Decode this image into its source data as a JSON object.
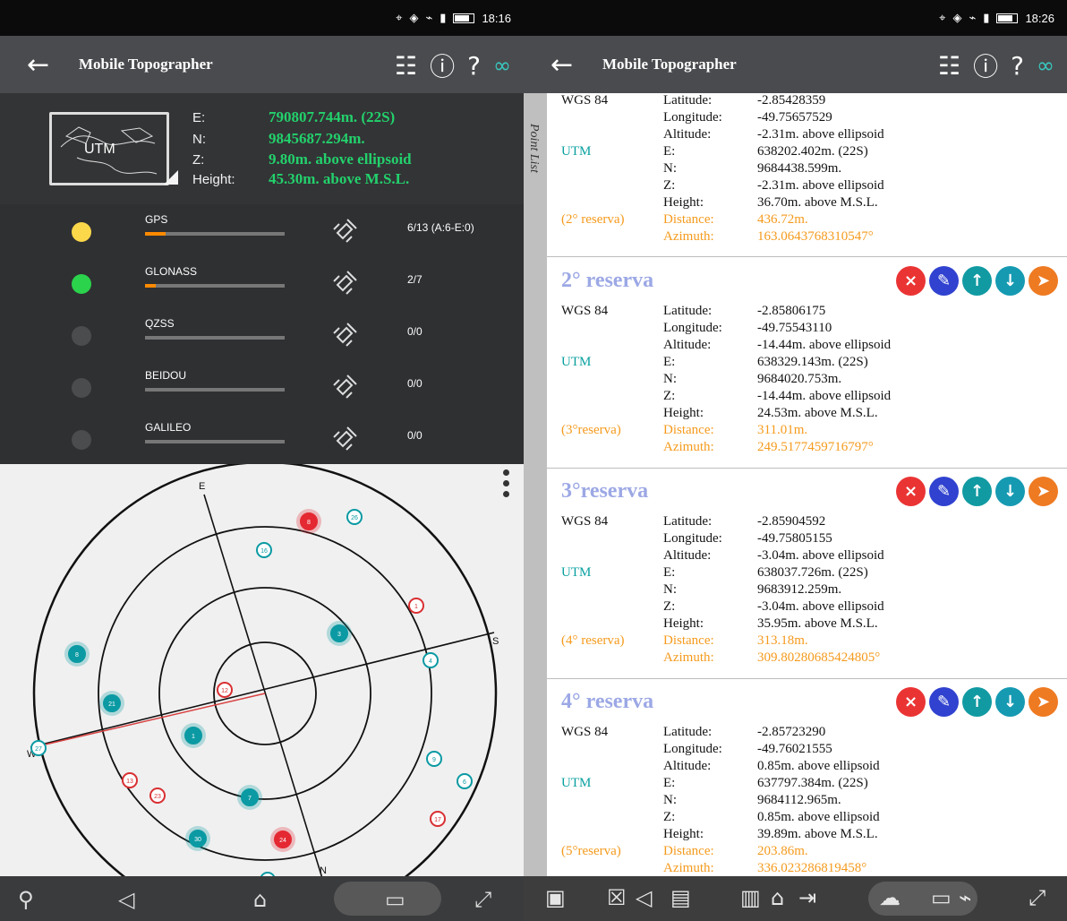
{
  "left_screen": {
    "status": {
      "time": "18:16"
    },
    "app_title": "Mobile Topographer",
    "coordinate": {
      "map_label": "UTM",
      "rows": [
        {
          "key": "E:",
          "value": "790807.744m. (22S)"
        },
        {
          "key": "N:",
          "value": "9845687.294m."
        },
        {
          "key": "Z:",
          "value": "9.80m. above ellipsoid"
        },
        {
          "key": "Height:",
          "value": "45.30m. above M.S.L."
        }
      ]
    },
    "satellites": [
      {
        "name": "GPS",
        "count": "6/13 (A:6-E:0)",
        "color": "#fbd84a",
        "signal_fraction": 0.15
      },
      {
        "name": "GLONASS",
        "count": "2/7",
        "color": "#2bd24c",
        "signal_fraction": 0.08
      },
      {
        "name": "QZSS",
        "count": "0/0",
        "color": "#4b4c4e",
        "signal_fraction": 0
      },
      {
        "name": "BEIDOU",
        "count": "0/0",
        "color": "#4b4c4e",
        "signal_fraction": 0
      },
      {
        "name": "GALILEO",
        "count": "0/0",
        "color": "#4b4c4e",
        "signal_fraction": 0
      }
    ],
    "skyplot": {
      "directions": {
        "north": "N",
        "east": "E",
        "south": "S",
        "west": "W"
      },
      "satellites": [
        "8",
        "26",
        "16",
        "1",
        "3",
        "4",
        "8",
        "21",
        "12",
        "1",
        "27",
        "9",
        "13",
        "23",
        "7",
        "6",
        "30",
        "24",
        "17",
        "32"
      ]
    }
  },
  "right_screen": {
    "status": {
      "time": "18:26"
    },
    "app_title": "Mobile Topographer",
    "side_tab": "Point List",
    "first_record": {
      "lat_label": "Latitude:",
      "lat": "-2.85428359",
      "lon_label": "Longitude:",
      "lon": "-49.75657529",
      "alt_label": "Altitude:",
      "alt": "-2.31m. above ellipsoid",
      "utm_label": "UTM",
      "e_label": "E:",
      "e": "638202.402m. (22S)",
      "n_label": "N:",
      "n": "9684438.599m.",
      "z_label": "Z:",
      "z": "-2.31m. above ellipsoid",
      "height_label": "Height:",
      "height": "36.70m. above M.S.L.",
      "reference": "(2° reserva)",
      "distance_label": "Distance:",
      "distance": "436.72m.",
      "azimuth_label": "Azimuth:",
      "azimuth": "163.0643768310547°",
      "wgs_label": "WGS 84"
    },
    "records": [
      {
        "title": "2° reserva",
        "wgs_label": "WGS 84",
        "lat_label": "Latitude:",
        "lat": "-2.85806175",
        "lon_label": "Longitude:",
        "lon": "-49.75543110",
        "alt_label": "Altitude:",
        "alt": "-14.44m. above ellipsoid",
        "utm_label": "UTM",
        "e_label": "E:",
        "e": "638329.143m. (22S)",
        "n_label": "N:",
        "n": "9684020.753m.",
        "z_label": "Z:",
        "z": "-14.44m. above ellipsoid",
        "height_label": "Height:",
        "height": "24.53m. above M.S.L.",
        "reference": "(3°reserva)",
        "distance_label": "Distance:",
        "distance": "311.01m.",
        "azimuth_label": "Azimuth:",
        "azimuth": "249.5177459716797°"
      },
      {
        "title": "3°reserva",
        "wgs_label": "WGS 84",
        "lat_label": "Latitude:",
        "lat": "-2.85904592",
        "lon_label": "Longitude:",
        "lon": "-49.75805155",
        "alt_label": "Altitude:",
        "alt": "-3.04m. above ellipsoid",
        "utm_label": "UTM",
        "e_label": "E:",
        "e": "638037.726m. (22S)",
        "n_label": "N:",
        "n": "9683912.259m.",
        "z_label": "Z:",
        "z": "-3.04m. above ellipsoid",
        "height_label": "Height:",
        "height": "35.95m. above M.S.L.",
        "reference": "(4° reserva)",
        "distance_label": "Distance:",
        "distance": "313.18m.",
        "azimuth_label": "Azimuth:",
        "azimuth": "309.80280685424805°"
      },
      {
        "title": "4° reserva",
        "wgs_label": "WGS 84",
        "lat_label": "Latitude:",
        "lat": "-2.85723290",
        "lon_label": "Longitude:",
        "lon": "-49.76021555",
        "alt_label": "Altitude:",
        "alt": "0.85m. above ellipsoid",
        "utm_label": "UTM",
        "e_label": "E:",
        "e": "637797.384m. (22S)",
        "n_label": "N:",
        "n": "9684112.965m.",
        "z_label": "Z:",
        "z": "0.85m. above ellipsoid",
        "height_label": "Height:",
        "height": "39.89m. above M.S.L.",
        "reference": "(5°reserva)",
        "distance_label": "Distance:",
        "distance": "203.86m.",
        "azimuth_label": "Azimuth:",
        "azimuth": "336.023286819458°"
      }
    ]
  }
}
